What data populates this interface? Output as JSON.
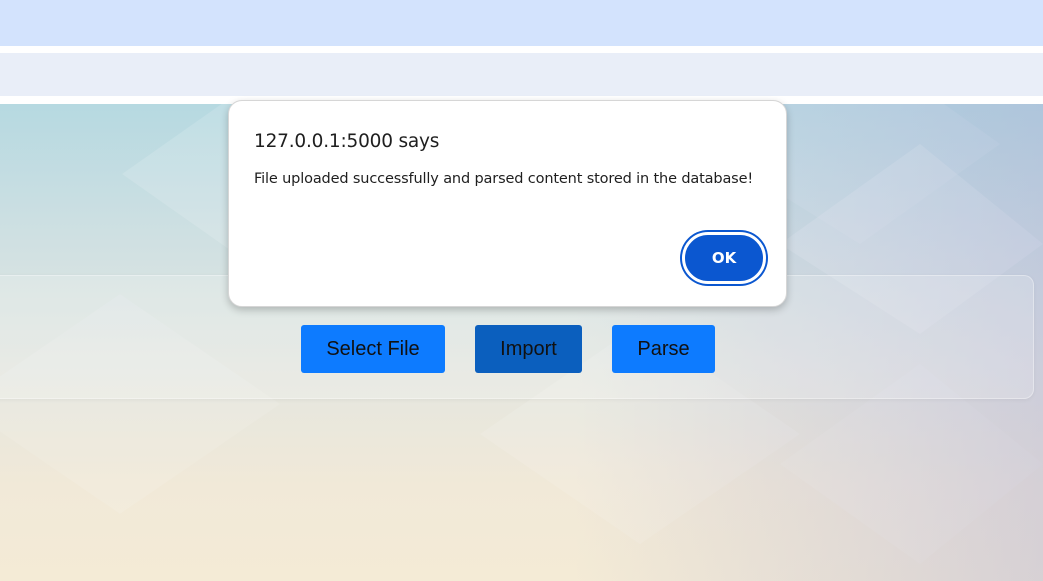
{
  "dialog": {
    "title": "127.0.0.1:5000 says",
    "message": "File uploaded successfully and parsed content stored in the database!",
    "ok_label": "OK"
  },
  "actions": {
    "select_file_label": "Select File",
    "import_label": "Import",
    "parse_label": "Parse"
  },
  "colors": {
    "primary_button": "#0d7bff",
    "active_button": "#0b5fbe",
    "dialog_accent": "#0b57d0",
    "tabstrip": "#d3e3fd",
    "toolbar": "#e9eef8"
  }
}
